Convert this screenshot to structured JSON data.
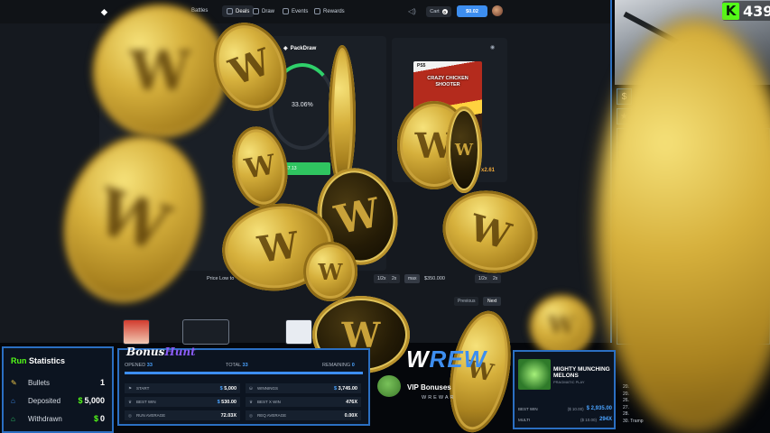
{
  "site": {
    "nav": {
      "battles": "Battles",
      "deals": "Deals",
      "draw": "Draw",
      "events": "Events",
      "rewards": "Rewards"
    },
    "cart_label": "Cart",
    "cart_count": "0",
    "balance": "$0.02",
    "packdraw_title": "PackDraw",
    "deal_percent": "33.06%",
    "deal_value": "$7.13",
    "product_platform": "PS5",
    "product_title": "CRAZY CHICKEN SHOOTER",
    "product_multiplier": "x2.61",
    "price_low_label": "Price Low to",
    "half_label": "1/2x",
    "double_label": "2x",
    "max_label": "max",
    "max_amount": "$350.000",
    "previous_label": "Previous",
    "next_label": "Next"
  },
  "viewers": {
    "count": "439"
  },
  "run_statistics": {
    "title_accent": "Run",
    "title_rest": "Statistics",
    "rows": [
      {
        "label": "Bullets",
        "currency": "",
        "value": "1"
      },
      {
        "label": "Deposited",
        "currency": "$",
        "value": "5,000"
      },
      {
        "label": "Withdrawn",
        "currency": "$",
        "value": "0"
      }
    ]
  },
  "bonus_hunt": {
    "logo_a": "Bonus",
    "logo_b": "Hunt",
    "opened_label": "OPENED",
    "opened_value": "33",
    "total_label": "TOTAL",
    "total_value": "33",
    "remaining_label": "REMAINING",
    "remaining_value": "0",
    "progress_fraction": 1.0,
    "cells": [
      {
        "label": "START",
        "currency": "$",
        "value": "5,000"
      },
      {
        "label": "WINNINGS",
        "currency": "$",
        "value": "3,745.00"
      },
      {
        "label": "BEST WIN",
        "currency": "$",
        "value": "530.00"
      },
      {
        "label": "BEST X WIN",
        "currency": "",
        "value": "476X"
      },
      {
        "label": "RUN AVERAGE",
        "currency": "",
        "value": "72.03X"
      },
      {
        "label": "REQ AVERAGE",
        "currency": "",
        "value": "0.00X"
      }
    ]
  },
  "wrewards": {
    "logo_w": "W",
    "logo_rest": "REW",
    "vip_text": "VIP Bonuses",
    "sub": "WREWAR"
  },
  "current_slot": {
    "name": "MIGHTY MUNCHING MELONS",
    "provider": "PRAGMATIC PLAY",
    "best_win_label": "BEST WIN",
    "best_win_bet": "($ 10.00)",
    "best_win_value": "$ 2,935.00",
    "multi_label": "MULTI",
    "multi_bet": "($ 10.00)",
    "multi_value": "294X"
  },
  "side_list": [
    "20.",
    "20.",
    "26.",
    "27.",
    "28.",
    "30. Tramp"
  ],
  "colors": {
    "accent_blue": "#2b6fc2",
    "kick_green": "#53fc18",
    "coin_gold": "#d6b03c"
  }
}
